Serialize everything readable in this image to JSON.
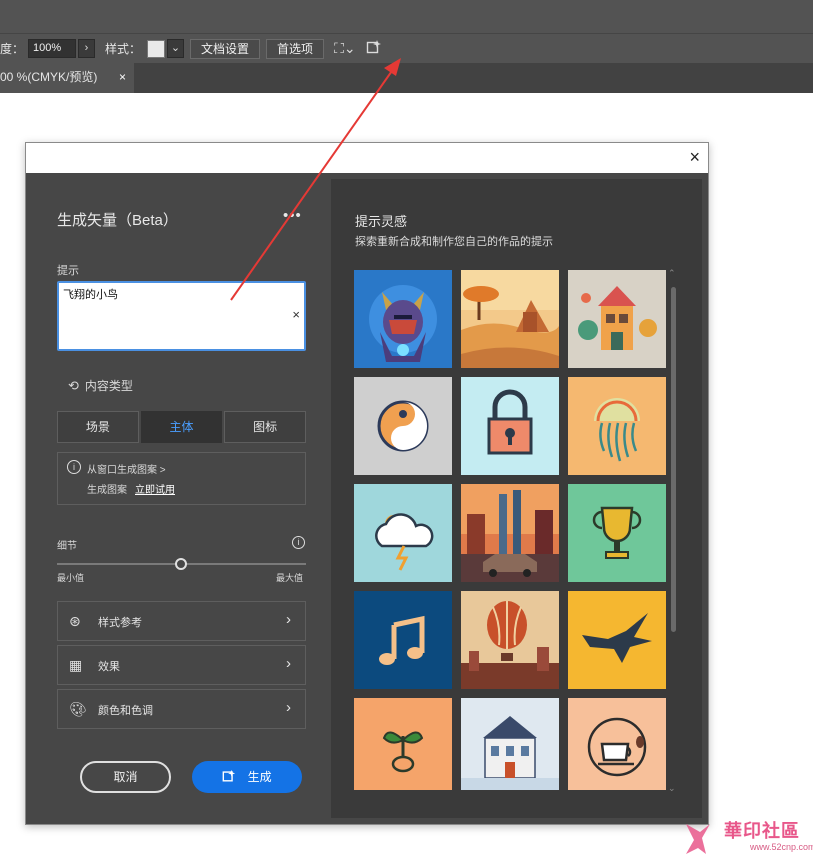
{
  "optbar": {
    "opacity_label": "度：",
    "opacity_value": "100%",
    "style_label": "样式：",
    "doc_settings": "文档设置",
    "preferences": "首选项"
  },
  "tab": {
    "label": "00 %(CMYK/预览)",
    "close": "×"
  },
  "dialog": {
    "close": "×",
    "title": "生成矢量（Beta）",
    "more": "•••",
    "prompt_label": "提示",
    "prompt_value": "飞翔的小鸟",
    "prompt_clear": "×",
    "content_type_label": "内容类型",
    "segments": [
      "场景",
      "主体",
      "图标"
    ],
    "active_segment": "主体",
    "hint_line1": "从窗口生成图案 >",
    "hint_line2_prefix": "生成图案",
    "hint_line2_link": "立即试用",
    "detail_label": "细节",
    "detail_level": 0.5,
    "min_label": "最小值",
    "max_label": "最大值",
    "accordions": [
      {
        "label": "样式参考",
        "icon": "style-reference-icon"
      },
      {
        "label": "效果",
        "icon": "effects-icon"
      },
      {
        "label": "颜色和色调",
        "icon": "palette-icon"
      }
    ],
    "cancel": "取消",
    "generate": "生成",
    "inspiration_title": "提示灵感",
    "inspiration_sub": "探索重新合成和制作您自己的作品的提示"
  },
  "colors": {
    "accent": "#1473e6",
    "active_segment_text": "#4a9eff",
    "arrow": "#e53935"
  },
  "watermark": {
    "text": "華印社區",
    "url": "www.52cnp.com"
  }
}
